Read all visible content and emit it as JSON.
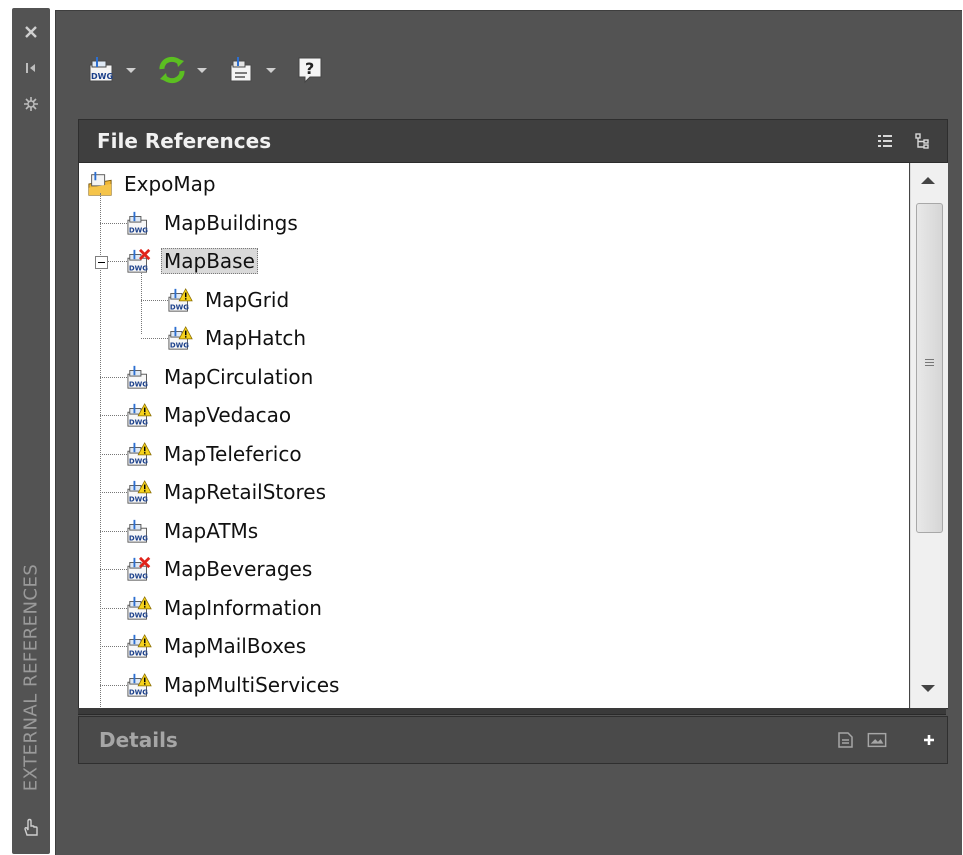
{
  "palette_title": "EXTERNAL REFERENCES",
  "titlebar_icons": [
    "close-icon",
    "autohide-icon",
    "properties-icon",
    "hand-icon"
  ],
  "toolbar": {
    "buttons": [
      {
        "name": "attach-dwg-button",
        "icon": "dwg-attach-icon"
      },
      {
        "name": "refresh-button",
        "icon": "refresh-icon"
      },
      {
        "name": "change-path-button",
        "icon": "change-path-icon"
      },
      {
        "name": "help-button",
        "icon": "help-icon"
      }
    ]
  },
  "file_references": {
    "title": "File References",
    "view_icons": [
      "list-view-icon",
      "tree-view-icon"
    ]
  },
  "tree": {
    "root": {
      "label": "ExpoMap",
      "icon": "drawing-root-icon"
    },
    "items": [
      {
        "label": "MapBuildings",
        "status": "ok",
        "level": 1
      },
      {
        "label": "MapBase",
        "status": "error",
        "level": 1,
        "expanded": true,
        "selected": true
      },
      {
        "label": "MapGrid",
        "status": "warning",
        "level": 2
      },
      {
        "label": "MapHatch",
        "status": "warning",
        "level": 2
      },
      {
        "label": "MapCirculation",
        "status": "ok",
        "level": 1
      },
      {
        "label": "MapVedacao",
        "status": "warning",
        "level": 1
      },
      {
        "label": "MapTeleferico",
        "status": "warning",
        "level": 1
      },
      {
        "label": "MapRetailStores",
        "status": "warning",
        "level": 1
      },
      {
        "label": "MapATMs",
        "status": "ok",
        "level": 1
      },
      {
        "label": "MapBeverages",
        "status": "error",
        "level": 1
      },
      {
        "label": "MapInformation",
        "status": "warning",
        "level": 1
      },
      {
        "label": "MapMailBoxes",
        "status": "warning",
        "level": 1
      },
      {
        "label": "MapMultiServices",
        "status": "warning",
        "level": 1
      }
    ]
  },
  "details": {
    "title": "Details",
    "icons": [
      "details-view-icon",
      "preview-icon",
      "expand-plus-icon"
    ]
  },
  "colors": {
    "panel_bg": "#535353",
    "header_bg": "#3f3f3f",
    "refresh_green": "#5bbf21",
    "warning_yellow": "#f5d21c",
    "error_red": "#e0241b"
  }
}
